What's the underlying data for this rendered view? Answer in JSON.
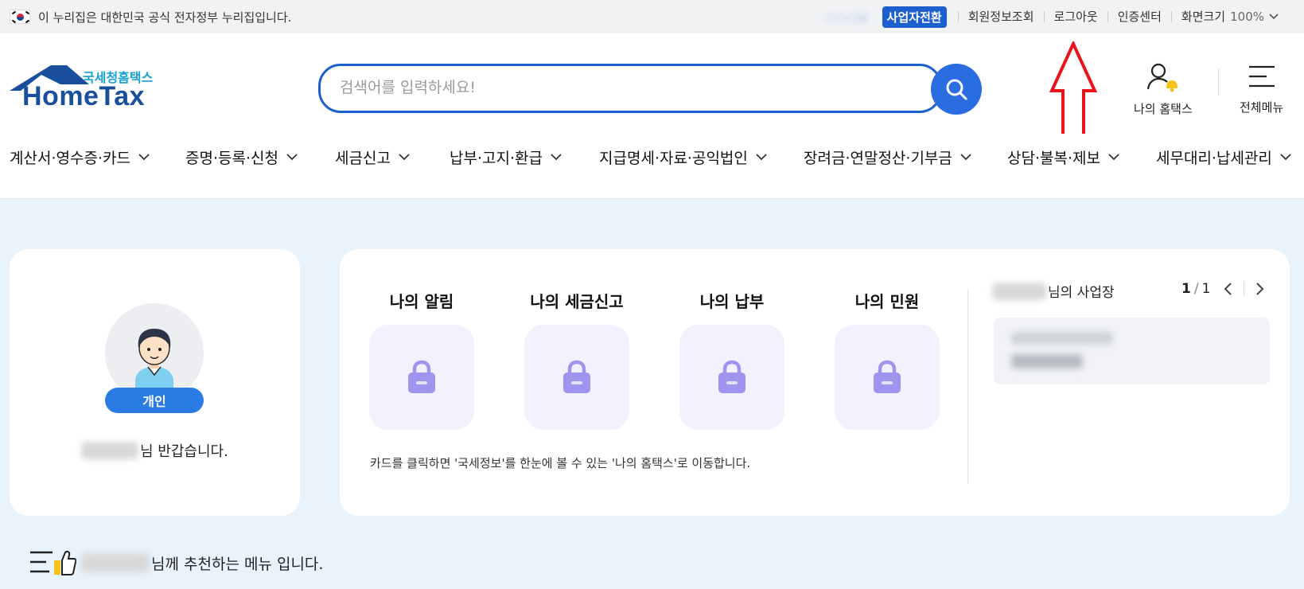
{
  "topbar": {
    "gov_notice": "이 누리집은 대한민국 공식 전자정부 누리집입니다.",
    "biz_switch": "사업자전환",
    "member_info": "회원정보조회",
    "logout": "로그아웃",
    "cert_center": "인증센터",
    "screen_size_label": "화면크기",
    "screen_size_value": "100%"
  },
  "logo": {
    "sub": "국세청홈택스",
    "main": "HomeTax"
  },
  "search": {
    "placeholder": "검색어를 입력하세요!"
  },
  "header": {
    "my_hometax": "나의 홈택스",
    "all_menu": "전체메뉴"
  },
  "gnb": [
    "계산서·영수증·카드",
    "증명·등록·신청",
    "세금신고",
    "납부·고지·환급",
    "지급명세·자료·공익법인",
    "장려금·연말정산·기부금",
    "상담·불복·제보",
    "세무대리·납세관리"
  ],
  "profile": {
    "badge": "개인",
    "greeting_suffix": "님 반갑습니다."
  },
  "tiles": [
    "나의 알림",
    "나의 세금신고",
    "나의 납부",
    "나의 민원"
  ],
  "note": "카드를 클릭하면 '국세정보'를 한눈에 볼 수 있는 '나의 홈택스'로 이동합니다.",
  "business": {
    "title_suffix": "님의 사업장",
    "page_current": "1",
    "page_total": "1"
  },
  "recommend": {
    "suffix": "님께 추천하는 메뉴 입니다."
  },
  "colors": {
    "primary": "#1d5fcf",
    "accent": "#2a7be4",
    "arrow": "#e8131b",
    "tile_bg": "#f2f1fd",
    "lock": "#9f95ef"
  }
}
